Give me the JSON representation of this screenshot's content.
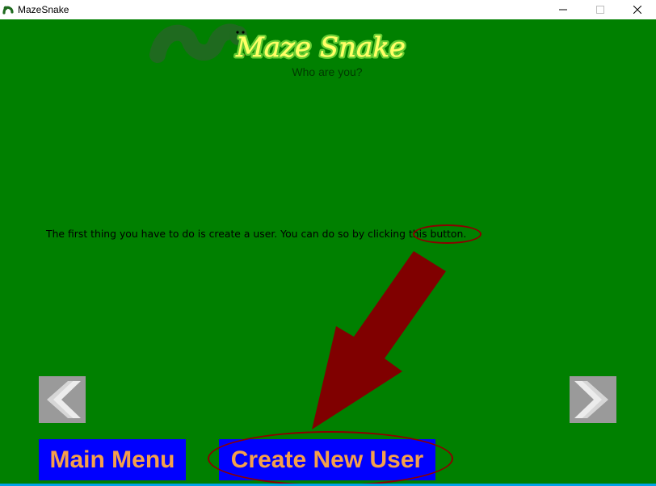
{
  "window": {
    "title": "MazeSnake",
    "icon": "snake-app-icon",
    "controls": [
      "minimize-icon",
      "maximize-icon",
      "close-icon"
    ]
  },
  "header": {
    "logo_text": "Maze Snake",
    "subtitle": "Who are you?"
  },
  "tutorial": {
    "text_before": "The first thing you have to do is create a user. You can do so by clicking ",
    "highlight": "this button."
  },
  "navigation": {
    "prev_icon": "chevron-left-icon",
    "next_icon": "chevron-right-icon"
  },
  "buttons": {
    "main_menu": "Main Menu",
    "create_new_user": "Create New User"
  },
  "colors": {
    "background": "#008000",
    "button_bg": "#0000ff",
    "button_text": "#f5a04a",
    "arrow": "#800000",
    "nav_button": "#9a9a9a"
  }
}
